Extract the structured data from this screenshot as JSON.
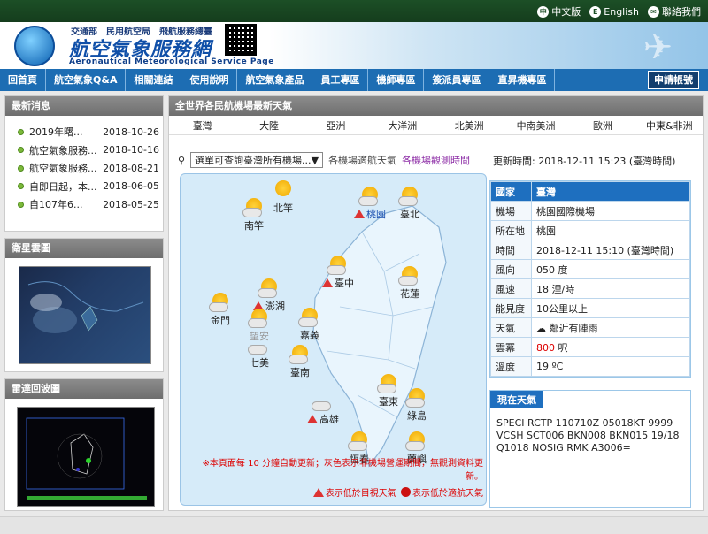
{
  "toplinks": {
    "chinese": "中文版",
    "english": "English",
    "contact": "聯絡我們"
  },
  "header": {
    "orgs": "交通部　民用航空局　飛航服務總臺",
    "site_name": "航空氣象服務網",
    "site_name_en": "Aeronautical Meteorological Service Page"
  },
  "nav": {
    "items": [
      "回首頁",
      "航空氣象Q&A",
      "相關連結",
      "使用說明",
      "航空氣象產品",
      "員工專區",
      "機師專區",
      "簽派員專區",
      "直昇機專區"
    ],
    "apply": "申請帳號"
  },
  "news": {
    "title": "最新消息",
    "items": [
      {
        "text": "2019年曙...",
        "date": "2018-10-26"
      },
      {
        "text": "航空氣象服務...",
        "date": "2018-10-16"
      },
      {
        "text": "航空氣象服務...",
        "date": "2018-08-21"
      },
      {
        "text": "自即日起，本...",
        "date": "2018-06-05"
      },
      {
        "text": "自107年6...",
        "date": "2018-05-25"
      }
    ]
  },
  "satellite": {
    "title": "衛星雲圖"
  },
  "radar": {
    "title": "雷達回波圖"
  },
  "main": {
    "title": "全世界各民航機場最新天氣",
    "regions": [
      "臺灣",
      "大陸",
      "亞洲",
      "大洋洲",
      "北美洲",
      "中南美洲",
      "歐洲",
      "中東&非洲"
    ],
    "select_value": "選單可查詢臺灣所有機場...",
    "legend_normal": "各機場適航天氣",
    "legend_obs": "各機場觀測時間",
    "updated": "更新時間: 2018-12-11 15:23 (臺灣時間)"
  },
  "stations": {
    "beigan": "北竿",
    "nangan": "南竿",
    "taoyuan": "桃園",
    "taipei": "臺北",
    "taichung": "臺中",
    "hualien": "花蓮",
    "penghu": "澎湖",
    "kinmen": "金門",
    "wangan": "望安",
    "qimei": "七美",
    "chiayi": "嘉義",
    "tainan": "臺南",
    "taitung": "臺東",
    "kaohsiung": "高雄",
    "ludao": "綠島",
    "hengchun": "恆春",
    "lanyu": "蘭嶼"
  },
  "map_notes": {
    "refresh": "※本頁面每 10 分鐘自動更新；灰色表示非機場營運期間，無觀測資料更新。",
    "below_visual": "表示低於目視天氣",
    "below_min": "表示低於適航天氣"
  },
  "info": {
    "header_key": "國家",
    "header_val": "臺灣",
    "rows": [
      {
        "k": "機場",
        "v": "桃園國際機場"
      },
      {
        "k": "所在地",
        "v": "桃園"
      },
      {
        "k": "時間",
        "v": "2018-12-11 15:10 (臺灣時間)"
      },
      {
        "k": "風向",
        "v": "050 度"
      },
      {
        "k": "風速",
        "v": "18 浬/時"
      },
      {
        "k": "能見度",
        "v": "10公里以上"
      },
      {
        "k": "天氣",
        "v": "鄰近有陣雨"
      },
      {
        "k": "雲冪",
        "v": "800",
        "unit": "呎"
      },
      {
        "k": "溫度",
        "v": "19 ºC"
      }
    ]
  },
  "current": {
    "title": "現在天氣",
    "metar": "SPECI RCTP 110710Z 05018KT 9999 VCSH SCT006 BKN008 BKN015 19/18 Q1018 NOSIG RMK A3006="
  }
}
